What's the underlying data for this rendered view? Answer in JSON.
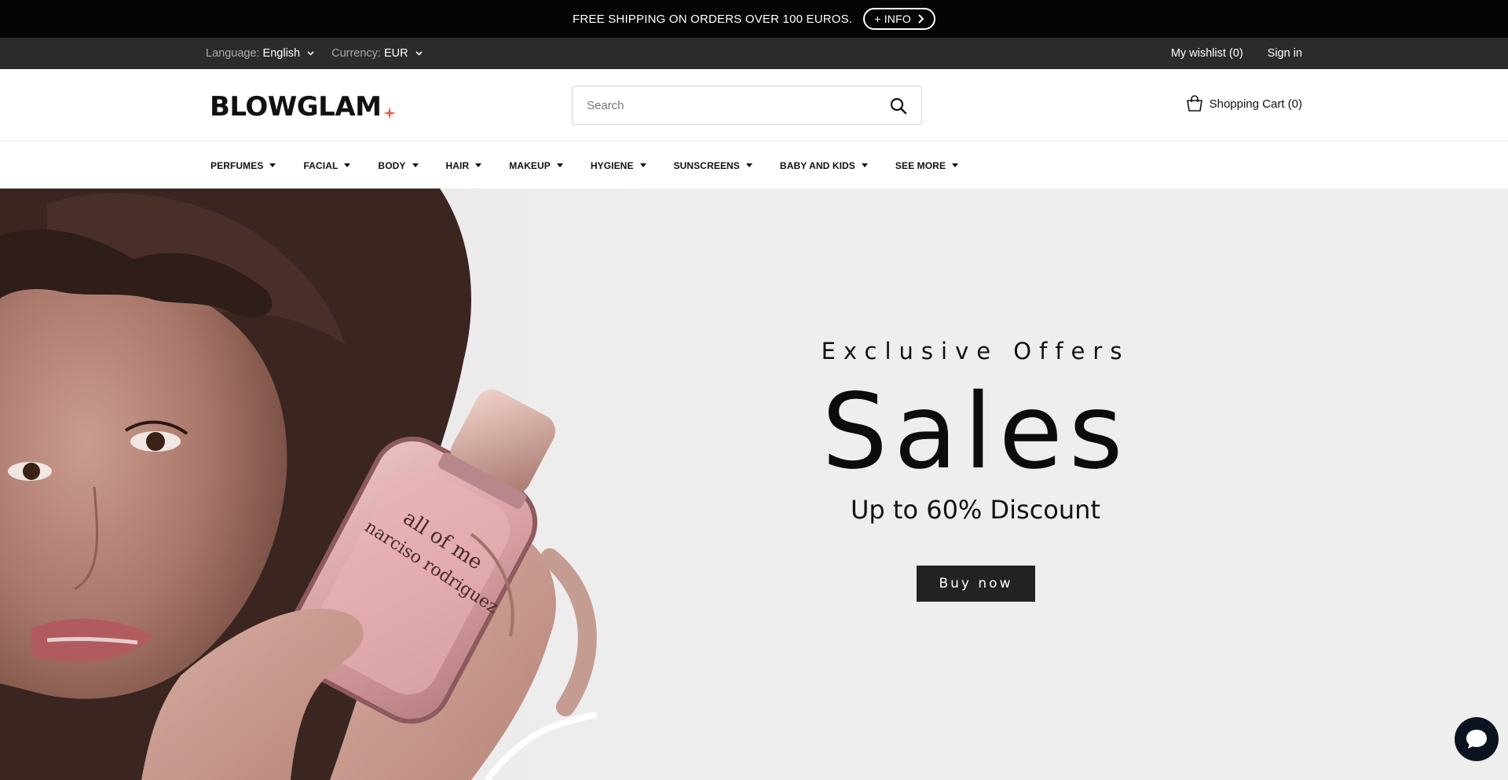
{
  "announcement": {
    "text": "FREE SHIPPING ON ORDERS OVER 100 EUROS.",
    "info_label": "+ INFO"
  },
  "utility": {
    "language_label": "Language:",
    "language_value": "English",
    "currency_label": "Currency:",
    "currency_value": "EUR",
    "wishlist": "My wishlist (0)",
    "sign_in": "Sign in"
  },
  "header": {
    "logo": "BLOWGLAM",
    "search_placeholder": "Search",
    "cart": "Shopping Cart (0)"
  },
  "nav": {
    "items": [
      {
        "label": "PERFUMES"
      },
      {
        "label": "FACIAL"
      },
      {
        "label": "BODY"
      },
      {
        "label": "HAIR"
      },
      {
        "label": "MAKEUP"
      },
      {
        "label": "HYGIENE"
      },
      {
        "label": "SUNSCREENS"
      },
      {
        "label": "BABY AND KIDS"
      },
      {
        "label": "SEE MORE"
      }
    ]
  },
  "hero": {
    "eyebrow": "Exclusive Offers",
    "headline": "Sales",
    "subheadline": "Up to 60% Discount",
    "cta": "Buy now",
    "bottle_text": "all of me narciso rodriguez"
  },
  "colors": {
    "announcement_bg": "#050505",
    "utility_bg": "#2b2b2b",
    "hero_bg": "#efeeee",
    "logo_accent": "#e8604c",
    "cta_bg": "#222222",
    "chat_bg": "#0b1320"
  },
  "icons": {
    "info_chevron": "chevron-right-icon",
    "dropdown": "chevron-down-icon",
    "search": "search-icon",
    "cart": "shopping-bag-icon",
    "chat": "chat-bubble-icon"
  }
}
